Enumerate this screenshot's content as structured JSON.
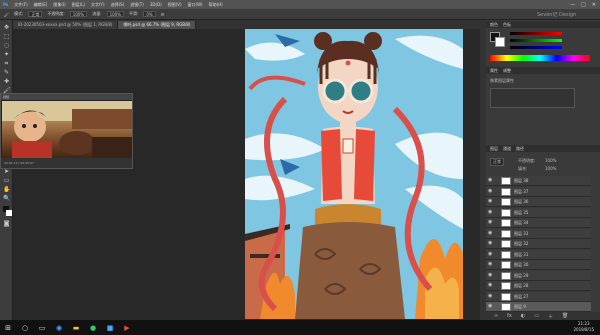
{
  "menu": [
    "文件(F)",
    "编辑(E)",
    "图像(I)",
    "图层(L)",
    "文字(Y)",
    "选择(S)",
    "滤镜(T)",
    "3D(D)",
    "视图(V)",
    "窗口(W)",
    "帮助(H)"
  ],
  "window_controls": {
    "minimize": "—",
    "maximize": "□",
    "close": "✕"
  },
  "options": {
    "mode_label": "模式:",
    "mode_value": "正常",
    "opacity_label": "不透明度:",
    "opacity_value": "100%",
    "flow_label": "流量:",
    "flow_value": "100%",
    "smooth_label": "平滑:",
    "smooth_value": "0%"
  },
  "tabs": [
    "ID-20230503-xxxxx.psd @ 50% (图层 1, RGB/8)",
    "哪吒.psd @ 66.7% (图层 9, RGB/8)"
  ],
  "video": {
    "title": "视频",
    "footer": "00:01:23 / 00:05:47"
  },
  "panels": {
    "color": {
      "tabs": [
        "颜色",
        "色板"
      ]
    },
    "props": {
      "tabs": [
        "属性",
        "调整"
      ],
      "subtitle": "像素图层属性"
    },
    "layers": {
      "tabs": [
        "图层",
        "通道",
        "路径"
      ],
      "blend": "正常",
      "opacity_label": "不透明度:",
      "opacity_value": "100%",
      "fill_label": "填充:",
      "fill_value": "100%"
    }
  },
  "layers": [
    {
      "name": "图层 38"
    },
    {
      "name": "图层 37"
    },
    {
      "name": "图层 36"
    },
    {
      "name": "图层 35"
    },
    {
      "name": "图层 34"
    },
    {
      "name": "图层 33"
    },
    {
      "name": "图层 32"
    },
    {
      "name": "图层 31"
    },
    {
      "name": "图层 30"
    },
    {
      "name": "图层 29"
    },
    {
      "name": "图层 28"
    },
    {
      "name": "图层 27"
    },
    {
      "name": "图层 9"
    }
  ],
  "taskbar": {
    "clock_time": "21:23",
    "clock_date": "2019/8/15"
  },
  "watermark": "Seven记 Design",
  "colors": {
    "accent": "#2d8cf0",
    "sky": "#7fc6e3",
    "vest": "#e84a3a",
    "ribbon": "#d9504a",
    "pants": "#8a5a3c"
  }
}
